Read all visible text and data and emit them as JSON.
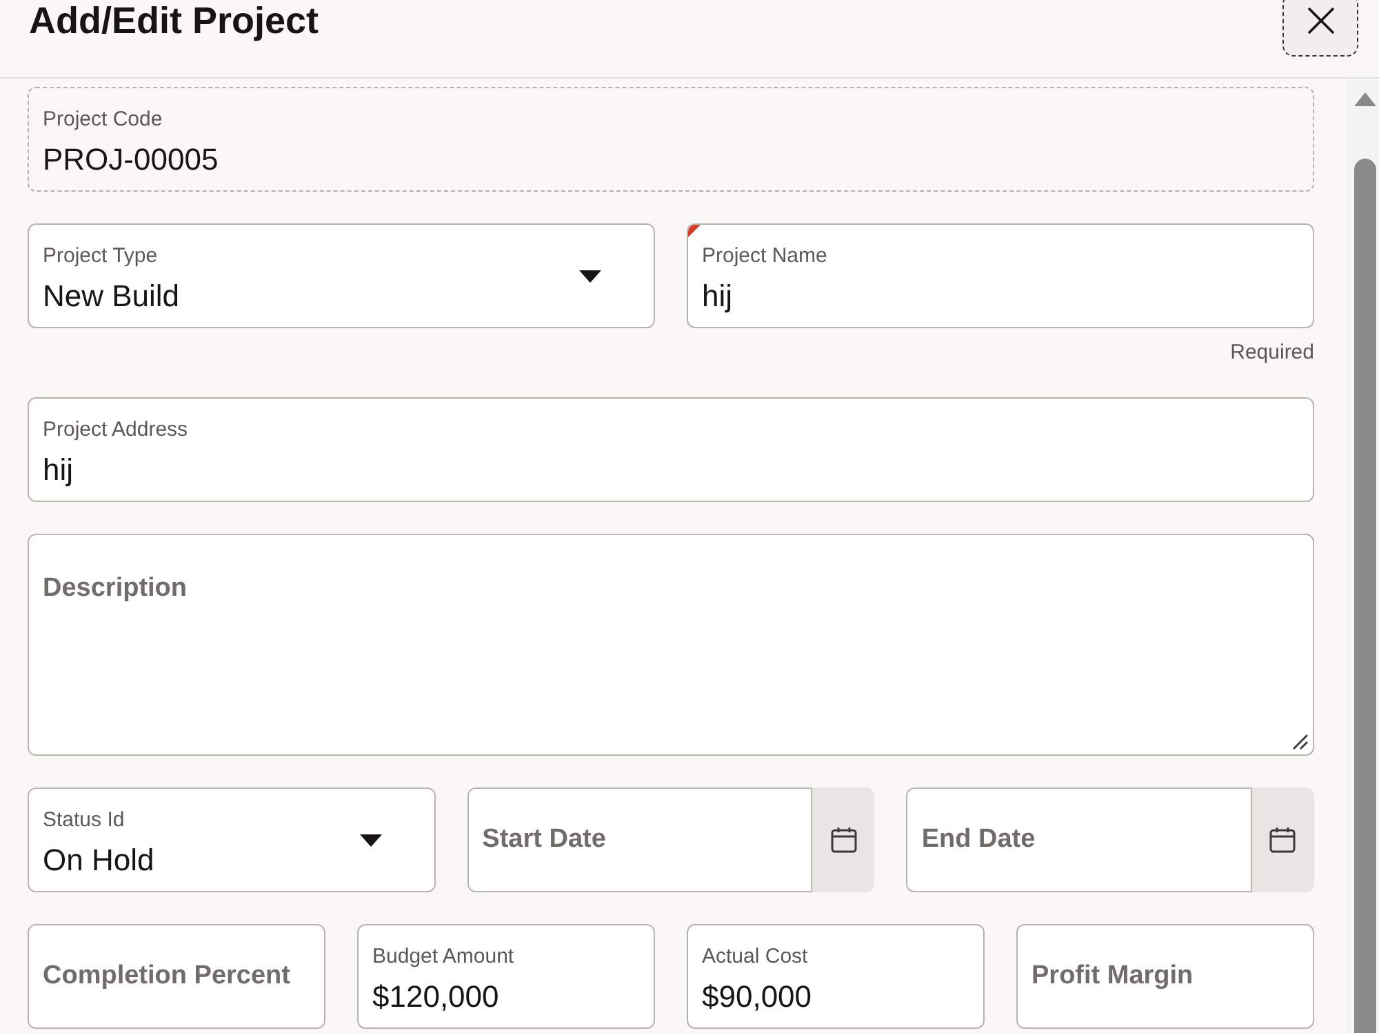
{
  "dialog": {
    "title": "Add/Edit Project",
    "close_button": {
      "focused": true
    }
  },
  "form": {
    "rows": [
      {
        "fields": [
          {
            "kind": "text",
            "label": "Project Code",
            "value": "PROJ-00005",
            "readonly": true,
            "required": false
          }
        ]
      },
      {
        "fields": [
          {
            "kind": "select",
            "label": "Project Type",
            "value": "New Build",
            "readonly": false,
            "required": false
          },
          {
            "kind": "text",
            "label": "Project Name",
            "value": "hij",
            "readonly": false,
            "required": true,
            "message": "Required"
          }
        ]
      },
      {
        "fields": [
          {
            "kind": "text",
            "label": "Project Address",
            "value": "hij",
            "readonly": false,
            "required": false
          }
        ]
      },
      {
        "fields": [
          {
            "kind": "textarea",
            "label": "Description",
            "readonly": false,
            "required": false
          }
        ]
      },
      {
        "fields": [
          {
            "kind": "select",
            "label": "Status Id",
            "value": "On Hold",
            "readonly": false,
            "required": false
          },
          {
            "kind": "date",
            "label": "Start Date",
            "readonly": false,
            "required": false
          },
          {
            "kind": "date",
            "label": "End Date",
            "readonly": false,
            "required": false
          }
        ]
      },
      {
        "fields": [
          {
            "kind": "text",
            "label": "Completion Percent",
            "readonly": false,
            "required": false
          },
          {
            "kind": "text",
            "label": "Budget Amount",
            "value": "$120,000",
            "readonly": false,
            "required": false
          },
          {
            "kind": "text",
            "label": "Actual Cost",
            "value": "$90,000",
            "readonly": false,
            "required": false
          },
          {
            "kind": "text",
            "label": "Profit Margin",
            "readonly": false,
            "required": false
          }
        ]
      }
    ]
  }
}
